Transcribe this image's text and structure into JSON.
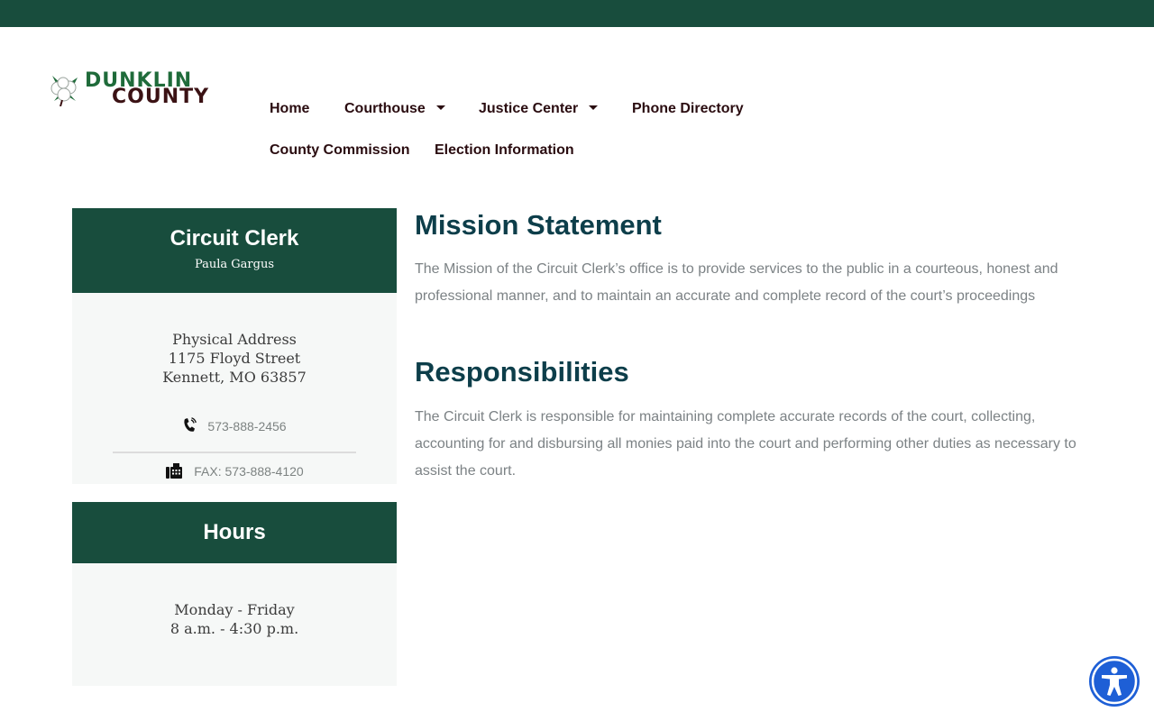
{
  "site": {
    "logo_line1": "DUNKLIN",
    "logo_line2": "COUNTY",
    "colors": {
      "brand_green": "#184d3d",
      "nav_text": "#2a0c10",
      "heading": "#0d3e4a",
      "a11y_blue": "#1e5fd6"
    }
  },
  "nav": {
    "home": "Home",
    "courthouse": "Courthouse",
    "justice_center": "Justice Center",
    "phone_directory": "Phone Directory",
    "county_commission": "County Commission",
    "election_information": "Election Information"
  },
  "office": {
    "title": "Circuit Clerk",
    "name": "Paula Gargus",
    "address_label": "Physical Address",
    "street": "1175 Floyd Street",
    "city": "Kennett, MO 63857",
    "phone": "573-888-2456",
    "fax": "FAX: 573-888-4120"
  },
  "hours": {
    "title": "Hours",
    "days": "Monday - Friday",
    "times": "8 a.m. - 4:30 p.m."
  },
  "content": {
    "mission_heading": "Mission Statement",
    "mission_text": "The Mission of the Circuit Clerk’s office is to provide services to the public in a courteous, honest and professional manner, and to maintain an accurate and complete record of the court’s proceedings",
    "resp_heading": "Responsibilities",
    "resp_text": "The Circuit Clerk is responsible for maintaining complete accurate records of the court, collecting, accounting for and disbursing all monies paid into the court and performing other duties as necessary to assist the court."
  },
  "icons": [
    "cotton-logo-icon",
    "chevron-down-icon",
    "phone-icon",
    "fax-icon",
    "accessibility-icon"
  ]
}
